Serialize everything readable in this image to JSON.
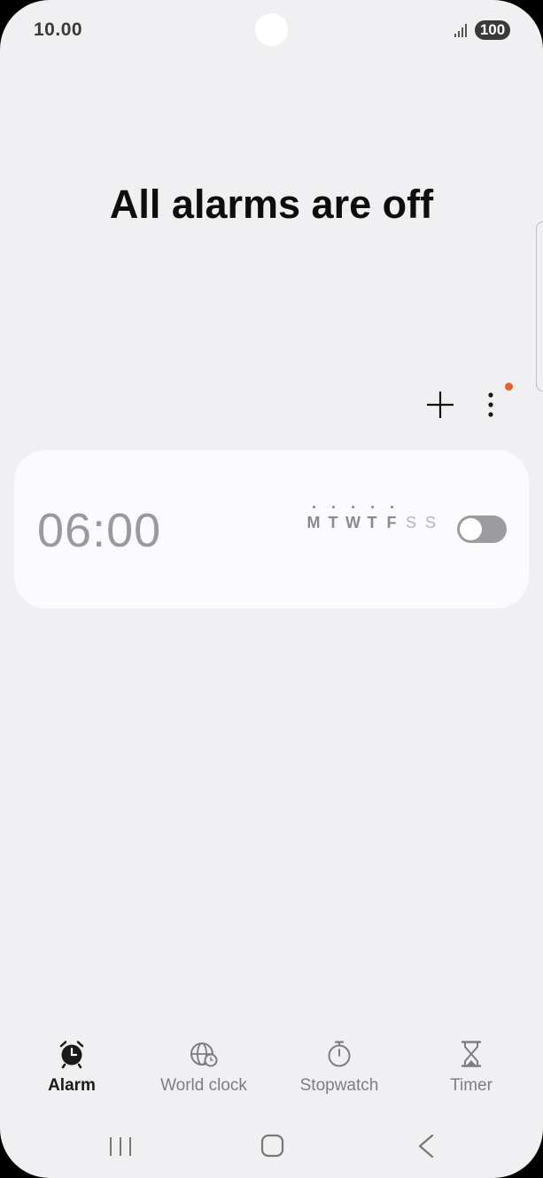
{
  "status_bar": {
    "time": "10.00",
    "battery": "100"
  },
  "headline": "All alarms are off",
  "toolbar": {
    "add_icon": "plus-icon",
    "more_icon": "more-vertical-icon",
    "notification_color": "#e8612c"
  },
  "alarm": {
    "time": "06:00",
    "enabled": false,
    "days": [
      {
        "label": "M",
        "active": true
      },
      {
        "label": "T",
        "active": true
      },
      {
        "label": "W",
        "active": true
      },
      {
        "label": "T",
        "active": true
      },
      {
        "label": "F",
        "active": true
      },
      {
        "label": "S",
        "active": false
      },
      {
        "label": "S",
        "active": false
      }
    ]
  },
  "tabs": [
    {
      "label": "Alarm",
      "icon": "alarm-clock-icon",
      "active": true
    },
    {
      "label": "World clock",
      "icon": "globe-clock-icon",
      "active": false
    },
    {
      "label": "Stopwatch",
      "icon": "stopwatch-icon",
      "active": false
    },
    {
      "label": "Timer",
      "icon": "hourglass-icon",
      "active": false
    }
  ],
  "navigation": {
    "recent": "recent-apps-icon",
    "home": "home-icon",
    "back": "back-icon"
  }
}
